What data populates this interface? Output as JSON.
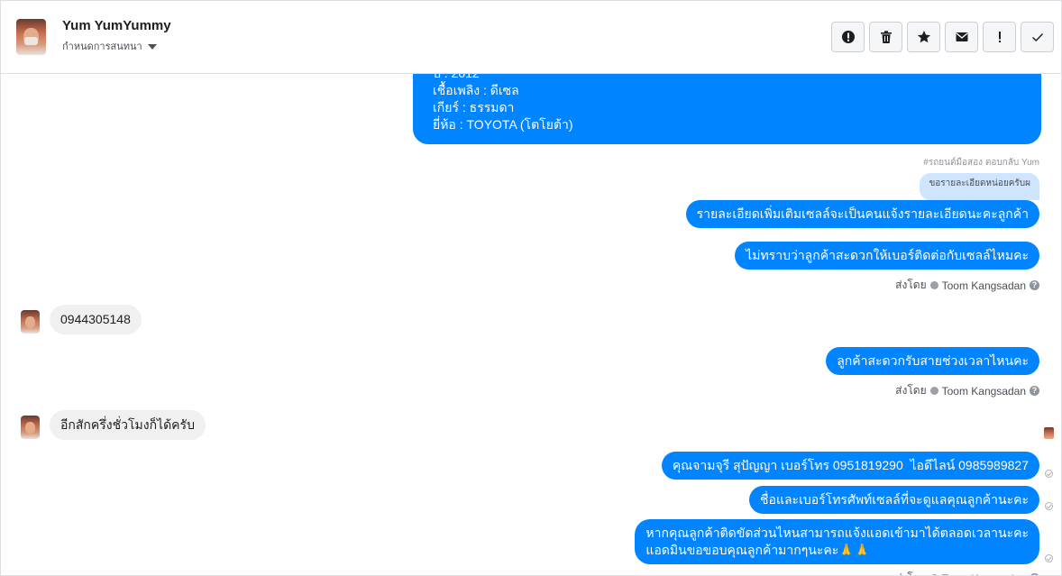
{
  "header": {
    "name": "Yum YumYummy",
    "subtitle": "กำหนดการสนทนา",
    "toolbar": [
      {
        "icon": "spam-icon"
      },
      {
        "icon": "trash-icon"
      },
      {
        "icon": "star-icon"
      },
      {
        "icon": "envelope-icon"
      },
      {
        "icon": "exclamation-icon"
      },
      {
        "icon": "check-icon"
      }
    ]
  },
  "messages": {
    "car_details": "ปี : 2012\nเชื้อเพลิง : ดีเซล\nเกียร์ : ธรรมดา\nยี่ห้อ : TOYOTA (โตโยต้า)",
    "reply_context": "#รถยนต์มือสอง ตอบกลับ Yum",
    "reply_quote": "ขอรายละเอียดหน่อยครับผ",
    "out_1": "รายละเอียดเพิ่มเติมเซลล์จะเป็นคนแจ้งรายละเอียดนะคะลูกค้า",
    "out_2": "ไม่ทราบว่าลูกค้าสะดวกให้เบอร์ติดต่อกับเซลล์ไหมคะ",
    "in_phone": "0944305148",
    "out_3": "ลูกค้าสะดวกรับสายช่วงเวลาไหนคะ",
    "in_time": "อีกสักครึ่งชั่วโมงก็ได้ครับ",
    "out_4": "คุณจามจุรี สุปัญญา เบอร์โทร 0951819290  ไอดีไลน์ 0985989827",
    "out_5": "ชื่อและเบอร์โทรศัพท์เซลล์ที่จะดูแลคุณลูกค้านะคะ",
    "out_6": "หากคุณลูกค้าติดขัดส่วนไหนสามารถแจ้งแอดเข้ามาได้ตลอดเวลานะคะ\nแอดมินขอขอบคุณลูกค้ามากๆนะคะ🙏🙏"
  },
  "sent_by": {
    "label": "ส่งโดย",
    "agent": "Toom Kangsadan"
  }
}
